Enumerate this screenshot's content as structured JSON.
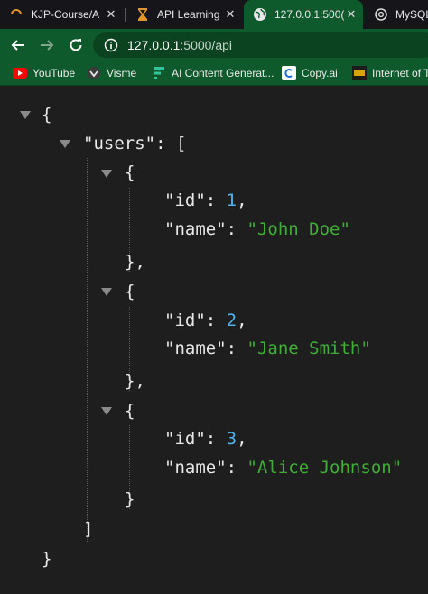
{
  "tabs": [
    {
      "title": "KJP-Course/A",
      "icon": "loading-spinner-icon",
      "active": false
    },
    {
      "title": "API Learning",
      "icon": "hourglass-icon",
      "active": false
    },
    {
      "title": "127.0.0.1:500(",
      "icon": "globe-icon",
      "active": true
    },
    {
      "title": "MySQL",
      "icon": "openai-icon",
      "active": false
    }
  ],
  "toolbar": {
    "url_host": "127.0.0.1",
    "url_path": ":5000/api"
  },
  "bookmarks": [
    {
      "label": "YouTube",
      "icon": "youtube-icon"
    },
    {
      "label": "Visme",
      "icon": "visme-icon"
    },
    {
      "label": "AI Content Generat...",
      "icon": "ai-content-icon"
    },
    {
      "label": "Copy.ai",
      "icon": "copyai-icon"
    },
    {
      "label": "Internet of T",
      "icon": "ucl-icon"
    }
  ],
  "json": {
    "open_brace": "{",
    "close_brace": "}",
    "users_key": "\"users\"",
    "colon": ":",
    "open_bracket": "[",
    "close_bracket": "]",
    "id_key": "\"id\"",
    "name_key": "\"name\"",
    "users": [
      {
        "id": "1",
        "name": "\"John Doe\""
      },
      {
        "id": "2",
        "name": "\"Jane Smith\""
      },
      {
        "id": "3",
        "name": "\"Alice Johnson\""
      }
    ]
  },
  "colors": {
    "toolbar": "#0f5a2c",
    "number": "#4fb4f0",
    "string": "#3fae36",
    "background": "#1e1e1e"
  }
}
